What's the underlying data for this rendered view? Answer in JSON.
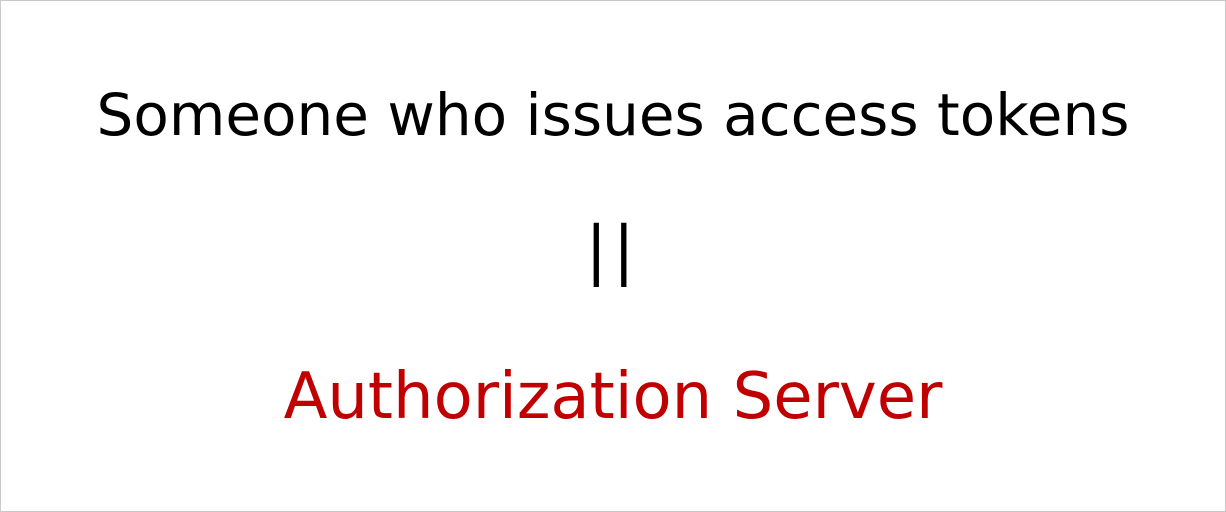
{
  "slide": {
    "statement": "Someone who issues access tokens",
    "equals_symbol": "||",
    "term": "Authorization Server"
  },
  "colors": {
    "statement_text": "#000000",
    "term_text": "#c00000",
    "border": "#c9c9c9",
    "background": "#ffffff"
  }
}
